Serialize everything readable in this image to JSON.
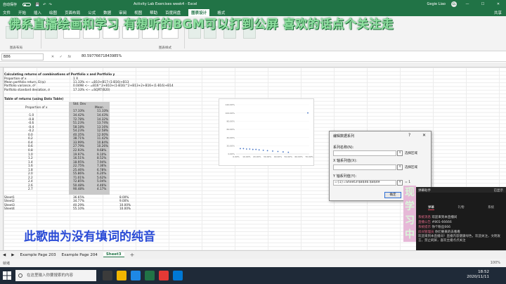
{
  "titlebar": {
    "autosave": "自动保存",
    "doc_title": "Activity Lab Exercises week4  -  Excel",
    "user_name": "Gegie Liao",
    "user_initials": "GL"
  },
  "menu": {
    "tabs": [
      "文件",
      "开始",
      "插入",
      "绘图",
      "页面布局",
      "公式",
      "数据",
      "审阅",
      "视图",
      "帮助",
      "百度网盘",
      "图表设计",
      "格式"
    ],
    "active": "图表设计",
    "share": "共享"
  },
  "ribbon": {
    "group_layout": "图表布局",
    "group_style": "图表样式"
  },
  "overlay": {
    "top": "佛系直播绘画和学习     有想听的BGM可以打到公屏     喜欢的话点个关注走",
    "mid": "此歌曲为没有填词的纯音",
    "side": [
      "现",
      "学",
      "习",
      "中"
    ]
  },
  "formula": {
    "namebox": "B86",
    "cancel": "✕",
    "confirm": "✓",
    "fx": "fx",
    "value": "80.59776671843985%"
  },
  "sheet": {
    "heading": "Calculating returns of combinations of Portfolio x and Portfolio y",
    "rows": [
      {
        "label": "Proportion of x",
        "v": "1  X"
      },
      {
        "label": "Mean portfolio return, E(rp)",
        "v": "11.33%  <-- =B10+B17-(1-B16)+B13"
      },
      {
        "label": "Portfolio variance, σ²",
        "v": "0.0498  <-- =B16^2+B10+(1-B16)^2+B13+2+B16+(1-B16)+B14"
      },
      {
        "label": "Portfolio standard deviation, σ",
        "v": "17.33%  <-- =SQRT(B20)"
      }
    ],
    "table_title": "Table of returns (using Data Table)",
    "table_head": [
      "Proportion of x",
      "Std. Dev",
      "Mean"
    ],
    "first_row": [
      "",
      "17.33%",
      "11.33%"
    ],
    "table": [
      [
        "-1.0",
        "34.42%",
        "14.43%"
      ],
      [
        "-0.8",
        "72.78%",
        "14.32%"
      ],
      [
        "-0.6",
        "51.23%",
        "13.74%"
      ],
      [
        "-0.4",
        "58.18%",
        "13.16%"
      ],
      [
        "-0.2",
        "54.23%",
        "12.58%"
      ],
      [
        "0.0",
        "40.35%",
        "12.00%"
      ],
      [
        "0.2",
        "38.71%",
        "11.42%"
      ],
      [
        "0.4",
        "33.99%",
        "10.84%"
      ],
      [
        "0.6",
        "27.79%",
        "10.26%"
      ],
      [
        "0.8",
        "22.93%",
        "9.68%"
      ],
      [
        "1.0",
        "19.97%",
        "9.10%"
      ],
      [
        "1.2",
        "16.51%",
        "8.52%"
      ],
      [
        "1.4",
        "18.95%",
        "7.94%"
      ],
      [
        "1.6",
        "22.75%",
        "7.36%"
      ],
      [
        "1.8",
        "25.46%",
        "6.78%"
      ],
      [
        "2.0",
        "55.86%",
        "6.20%"
      ],
      [
        "2.2",
        "71.01%",
        "5.62%"
      ],
      [
        "2.4",
        "72.85%",
        "5.04%"
      ],
      [
        "2.6",
        "50.48%",
        "4.46%"
      ],
      [
        "2.7",
        "90.48%",
        "4.17%"
      ]
    ],
    "sheet_rows": [
      {
        "name": "Sheet1",
        "sd": "36.65%",
        "mean": "8.00%"
      },
      {
        "name": "Sheet2",
        "sd": "34.77%",
        "mean": "9.00%"
      },
      {
        "name": "Sheet3",
        "sd": "40.29%",
        "mean": "10.00%"
      },
      {
        "name": "Sheet4",
        "sd": "55.10%",
        "mean": "10.00%"
      }
    ]
  },
  "chart": {
    "y_ticks": [
      "120.00%",
      "100.00%",
      "80.00%",
      "60.00%",
      "40.00%",
      "20.00%",
      "0.00%"
    ],
    "x_ticks": [
      "0.00%",
      "10.00%",
      "20.00%",
      "30.00%",
      "40.00%",
      "50.00%",
      "60.00%",
      "70.00%"
    ]
  },
  "chart_data": {
    "type": "scatter",
    "xlim": [
      0,
      0.7
    ],
    "ylim": [
      0,
      1.2
    ],
    "points": [
      [
        0.8,
        1.0
      ],
      [
        0.04,
        0.13
      ],
      [
        0.07,
        0.13
      ],
      [
        0.1,
        0.12
      ],
      [
        0.13,
        0.12
      ],
      [
        0.16,
        0.11
      ],
      [
        0.19,
        0.11
      ],
      [
        0.22,
        0.1
      ],
      [
        0.26,
        0.09
      ],
      [
        0.3,
        0.08
      ],
      [
        0.35,
        0.07
      ],
      [
        0.4,
        0.06
      ],
      [
        0.45,
        0.05
      ],
      [
        0.5,
        0.04
      ]
    ]
  },
  "dialog": {
    "title": "编辑数据系列",
    "help": "?",
    "close": "✕",
    "series_name_label": "系列名称(N):",
    "series_name_value": "",
    "x_label": "X 轴系列值(X):",
    "x_value": "",
    "y_label": "Y 轴系列值(Y):",
    "y_value": "={1}=Sheet3!$B$46:$B$49",
    "select_range": "选择区域",
    "eq1": "= 1",
    "ok": "确定",
    "cancel": "取消"
  },
  "chat": {
    "title": "弹幕助手",
    "status": "已显示",
    "tabs": [
      "弹幕",
      "礼物",
      "系统"
    ],
    "messages": [
      {
        "user": "系统消息",
        "text": "欢迎来到本直播间"
      },
      {
        "user": "直播公告",
        "text": "#801-66666"
      },
      {
        "user": "系统提示",
        "text": "你个粉丝666"
      },
      {
        "user": "房间管理员",
        "text": "你们要来的去看看"
      }
    ],
    "notice": "欢迎来到本直播间！直播内容健康绿色，欢迎关注，文明发言，禁止刷屏，喜欢主播点点关注"
  },
  "sheettabs": {
    "nav": [
      "◀",
      "▶"
    ],
    "tabs": [
      "Example Page 203",
      "Example Page 204",
      "Sheet3"
    ],
    "active": "Sheet3",
    "add": "+"
  },
  "status": {
    "ready": "就绪",
    "zoom": "100%"
  },
  "taskbar": {
    "search_placeholder": "在这里输入你要搜索的内容",
    "time": "18:52",
    "date": "2020/11/11"
  }
}
